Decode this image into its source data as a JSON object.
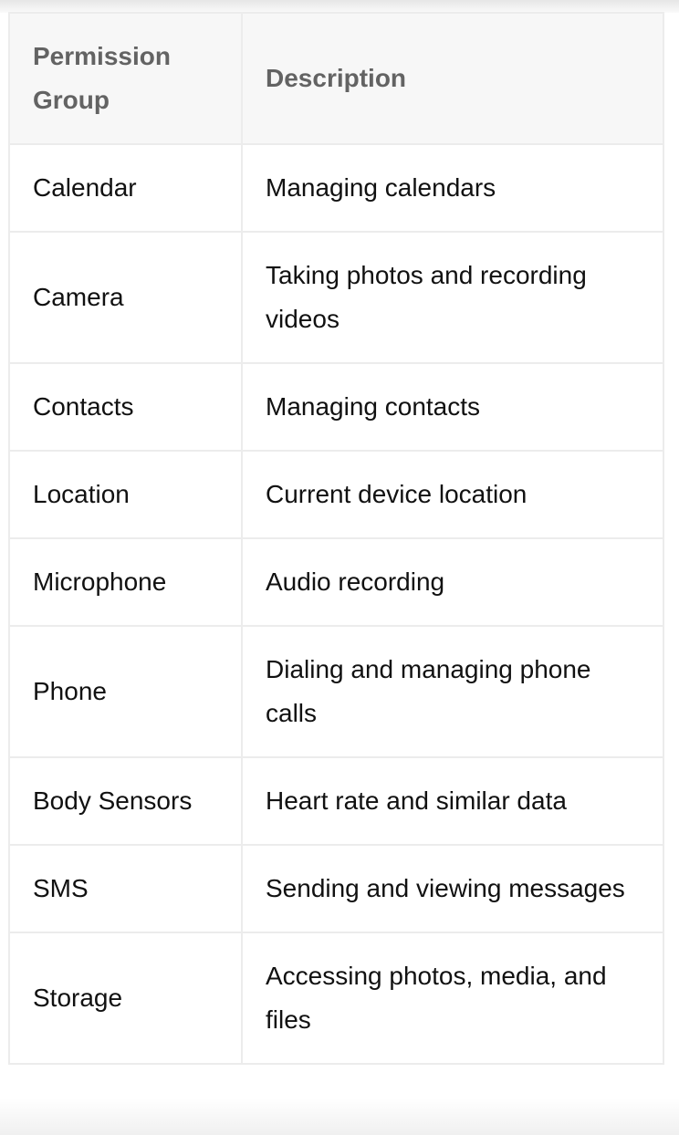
{
  "table": {
    "headers": [
      "Permission Group",
      "Description"
    ],
    "rows": [
      {
        "group": "Calendar",
        "description": "Managing calendars"
      },
      {
        "group": "Camera",
        "description": "Taking photos and recording videos"
      },
      {
        "group": "Contacts",
        "description": "Managing contacts"
      },
      {
        "group": "Location",
        "description": "Current device location"
      },
      {
        "group": "Microphone",
        "description": "Audio recording"
      },
      {
        "group": "Phone",
        "description": "Dialing and managing phone calls"
      },
      {
        "group": "Body Sensors",
        "description": "Heart rate and similar data"
      },
      {
        "group": "SMS",
        "description": "Sending and viewing messages"
      },
      {
        "group": "Storage",
        "description": "Accessing photos, media, and files"
      }
    ]
  }
}
